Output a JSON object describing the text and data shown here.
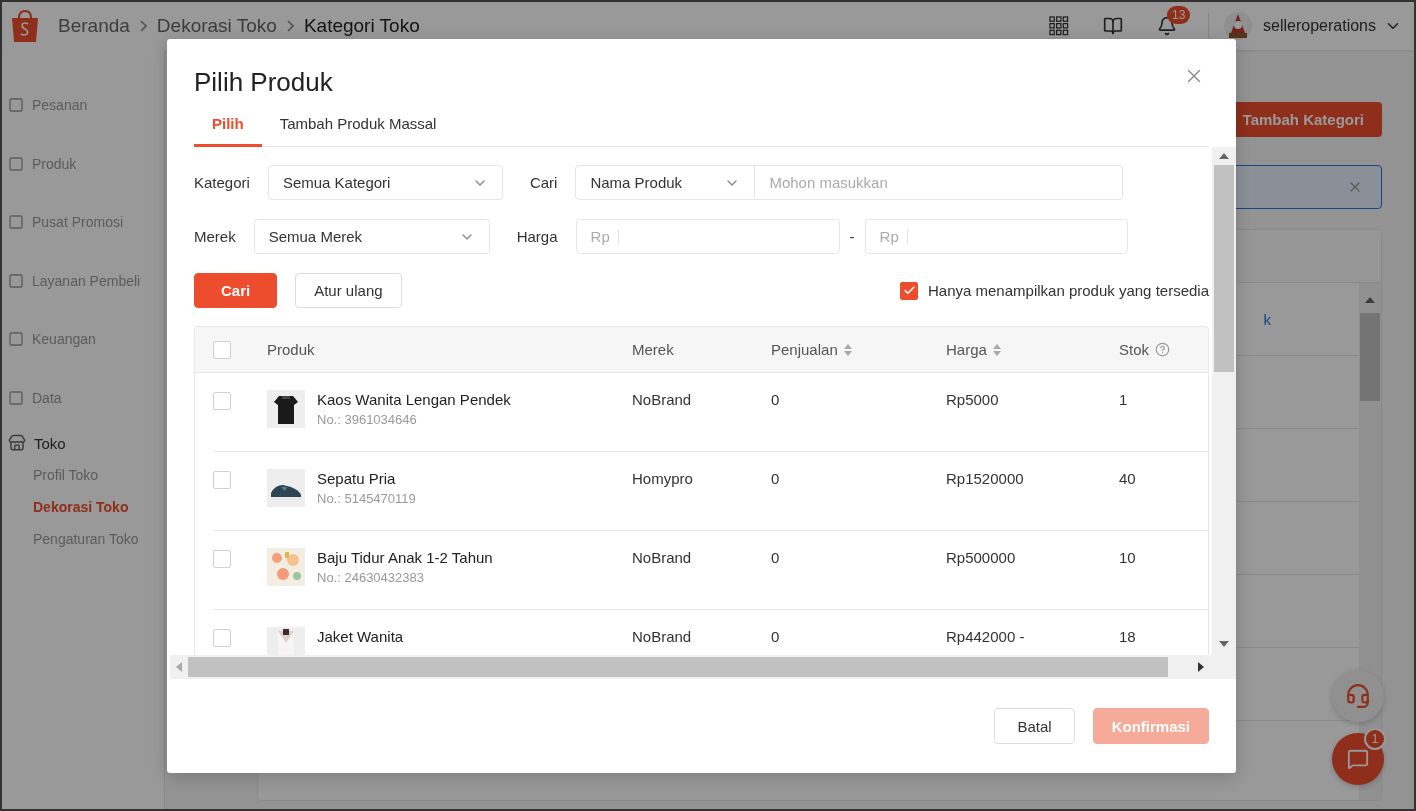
{
  "top_bar": {
    "breadcrumbs": [
      {
        "label": "Beranda",
        "current": false
      },
      {
        "label": "Dekorasi Toko",
        "current": false
      },
      {
        "label": "Kategori Toko",
        "current": true
      }
    ],
    "notification_count": "13",
    "username": "selleroperations"
  },
  "sidebar": {
    "items": [
      {
        "label": "Pesanan",
        "expanded": false
      },
      {
        "label": "Produk",
        "expanded": false
      },
      {
        "label": "Pusat Promosi",
        "expanded": false
      },
      {
        "label": "Layanan Pembeli",
        "expanded": false
      },
      {
        "label": "Keuangan",
        "expanded": false
      },
      {
        "label": "Data",
        "expanded": false
      },
      {
        "label": "Toko",
        "expanded": true,
        "children": [
          {
            "label": "Profil Toko",
            "selected": false
          },
          {
            "label": "Dekorasi Toko",
            "selected": true
          },
          {
            "label": "Pengaturan Toko",
            "selected": false
          }
        ]
      }
    ]
  },
  "page": {
    "add_button": "Tambah Kategori",
    "link_fragment": "k",
    "chat_badge": "1"
  },
  "modal": {
    "title": "Pilih Produk",
    "tabs": [
      {
        "label": "Pilih",
        "selected": true
      },
      {
        "label": "Tambah Produk Massal",
        "selected": false
      }
    ],
    "filters": {
      "category_label": "Kategori",
      "category_value": "Semua Kategori",
      "search_label": "Cari",
      "search_type": "Nama Produk",
      "search_placeholder": "Mohon masukkan",
      "brand_label": "Merek",
      "brand_value": "Semua Merek",
      "price_label": "Harga",
      "price_min_placeholder": "Rp",
      "price_separator": "-",
      "price_max_placeholder": "Rp"
    },
    "search_button": "Cari",
    "reset_button": "Atur ulang",
    "available_only": {
      "label": "Hanya menampilkan produk yang tersedia",
      "checked": true
    },
    "table": {
      "select_all_checked": false,
      "columns": [
        {
          "label": "Produk",
          "sortable": false,
          "help": false
        },
        {
          "label": "Merek",
          "sortable": false,
          "help": false
        },
        {
          "label": "Penjualan",
          "sortable": true,
          "help": false
        },
        {
          "label": "Harga",
          "sortable": true,
          "help": false
        },
        {
          "label": "Stok",
          "sortable": false,
          "help": true
        }
      ],
      "rows": [
        {
          "checked": false,
          "name": "Kaos Wanita Lengan Pendek",
          "number": "No.: 3961034646",
          "brand": "NoBrand",
          "sales": "0",
          "price": "Rp5000",
          "stock": "1"
        },
        {
          "checked": false,
          "name": "Sepatu Pria",
          "number": "No.: 5145470119",
          "brand": "Homypro",
          "sales": "0",
          "price": "Rp1520000",
          "stock": "40"
        },
        {
          "checked": false,
          "name": "Baju Tidur Anak 1-2 Tahun",
          "number": "No.: 24630432383",
          "brand": "NoBrand",
          "sales": "0",
          "price": "Rp500000",
          "stock": "10"
        },
        {
          "checked": false,
          "name": "Jaket Wanita",
          "brand": "NoBrand",
          "sales": "0",
          "price": "Rp442000 -",
          "stock": "18"
        }
      ]
    },
    "cancel_button": "Batal",
    "confirm_button": {
      "label": "Konfirmasi",
      "disabled": true
    }
  }
}
